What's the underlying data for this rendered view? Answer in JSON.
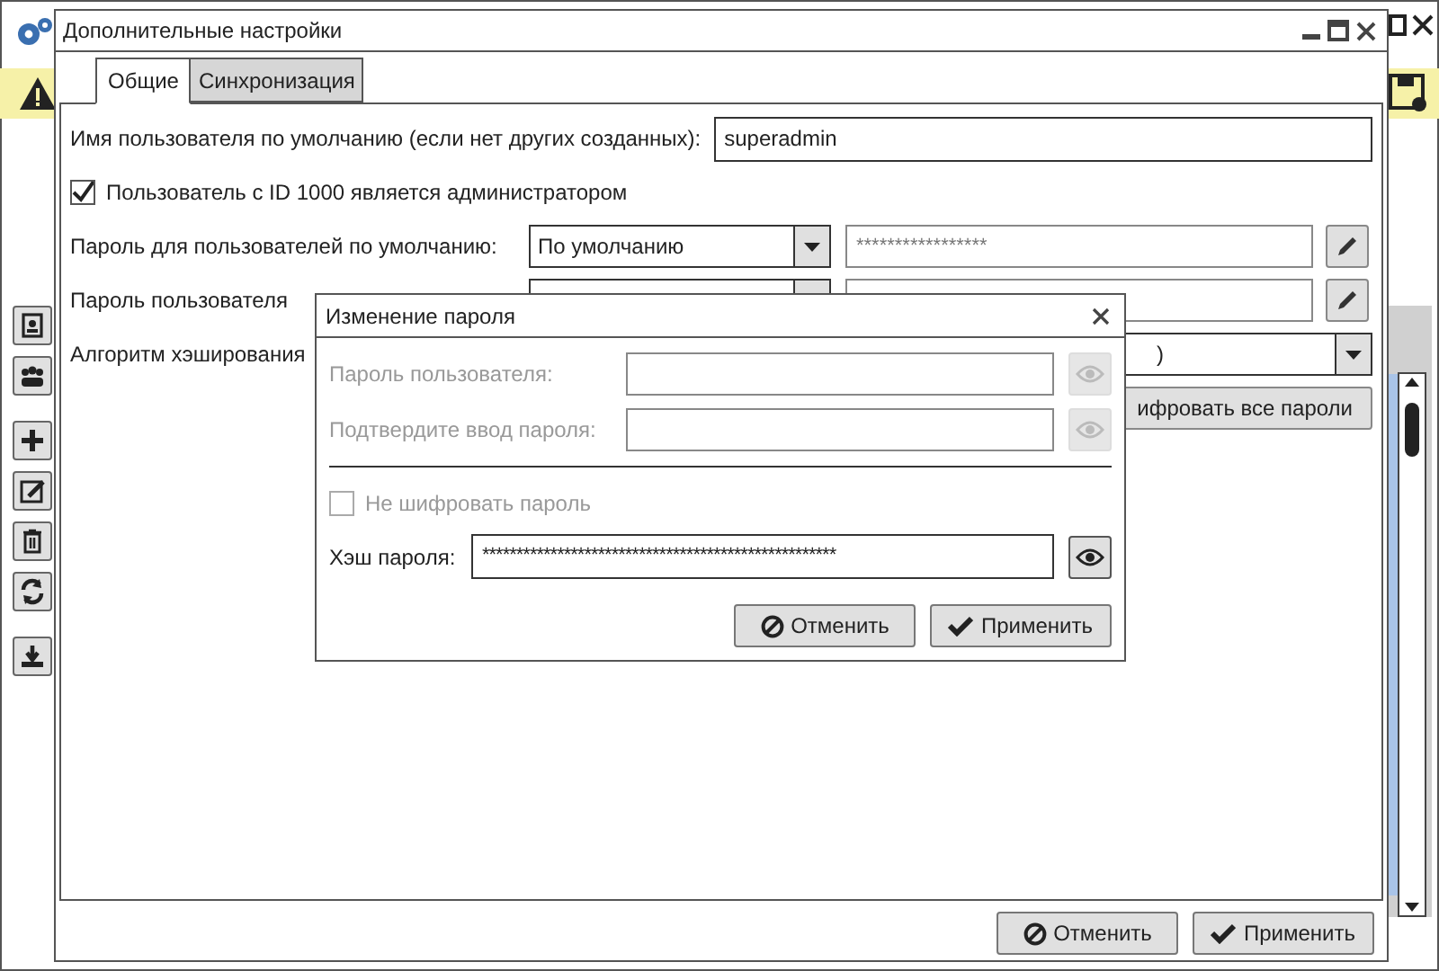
{
  "dialog": {
    "title": "Дополнительные настройки",
    "tabs": [
      {
        "label": "Общие",
        "selected": true
      },
      {
        "label": "Синхронизация",
        "selected": false
      }
    ],
    "default_user": {
      "label": "Имя пользователя по умолчанию (если нет других созданных):",
      "value": "superadmin"
    },
    "admin_checkbox": {
      "label": "Пользователь с ID 1000 является администратором",
      "checked": true
    },
    "password_rows": [
      {
        "label": "Пароль для пользователей по умолчанию:",
        "mode": "По умолчанию",
        "hash": "*****************"
      },
      {
        "label": "Пароль пользователя"
      }
    ],
    "hash_algorithm": {
      "label": "Алгоритм хэширования",
      "value": ")"
    },
    "encrypt_all_button": "ифровать все пароли",
    "buttons": [
      {
        "label": "Отменить",
        "kind": "cancel"
      },
      {
        "label": "Применить",
        "kind": "apply"
      }
    ]
  },
  "modal": {
    "title": "Изменение пароля",
    "fields": [
      {
        "label": "Пароль пользователя:",
        "disabled": true
      },
      {
        "label": "Подтвердите ввод пароля:",
        "disabled": true
      }
    ],
    "no_encrypt": {
      "label": "Не шифровать пароль",
      "checked": false,
      "disabled": true
    },
    "hash": {
      "label": "Хэш пароля:",
      "value": "****************************************************"
    },
    "buttons": [
      {
        "label": "Отменить",
        "kind": "cancel"
      },
      {
        "label": "Применить",
        "kind": "apply"
      }
    ]
  }
}
